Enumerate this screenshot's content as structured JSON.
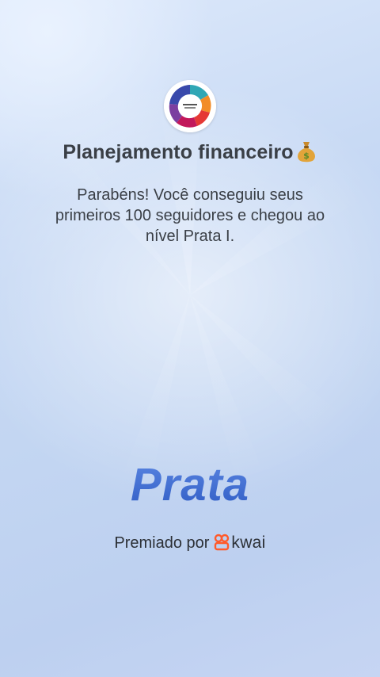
{
  "profile": {
    "avatar_icon": "financial-planning-cycle-icon",
    "title": "Planejamento financeiro",
    "title_emoji": "money-bag-icon"
  },
  "message": "Parabéns! Você conseguiu seus primeiros 100 seguidores e chegou ao nível Prata I.",
  "level": {
    "name": "Prata",
    "color": "#3d6dd2"
  },
  "award": {
    "prefix": "Premiado por",
    "logo_icon": "kwai-logo-icon",
    "brand": "kwai",
    "brand_color": "#ff5a2a"
  },
  "colors": {
    "background": "#c7d9f4",
    "text": "#3a3f46"
  }
}
